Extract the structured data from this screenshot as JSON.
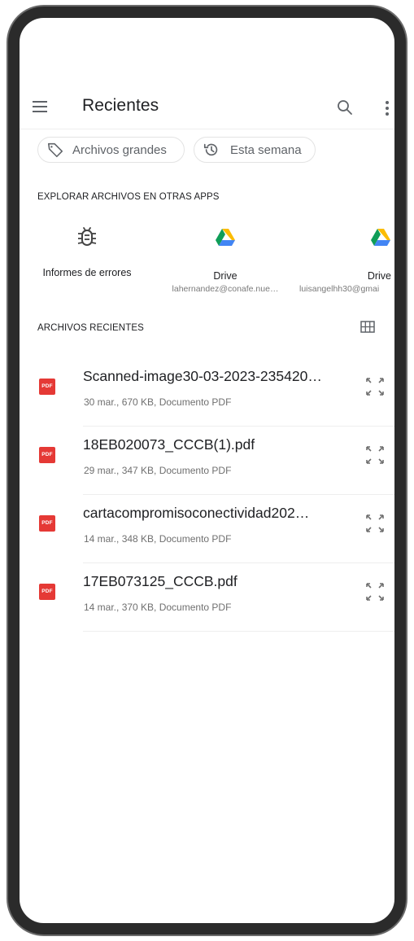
{
  "header": {
    "title": "Recientes",
    "menu_icon": "menu-icon",
    "search_icon": "search-icon",
    "more_icon": "more-vert-icon"
  },
  "chips": [
    {
      "label": "Archivos grandes",
      "icon": "tag-icon"
    },
    {
      "label": "Esta semana",
      "icon": "history-icon"
    }
  ],
  "explore": {
    "heading": "EXPLORAR ARCHIVOS EN OTRAS APPS",
    "apps": [
      {
        "label": "Informes de errores",
        "sub": "",
        "icon": "bug-icon"
      },
      {
        "label": "Drive",
        "sub": "lahernandez@conafe.nue…",
        "icon": "drive-icon"
      },
      {
        "label": "Drive",
        "sub": "luisangelhh30@gmai",
        "icon": "drive-icon"
      }
    ]
  },
  "recent": {
    "heading": "ARCHIVOS RECIENTES",
    "grid_icon": "grid-view-icon",
    "files": [
      {
        "name": "Scanned-image30-03-2023-235420…",
        "meta": "30 mar., 670 KB, Documento PDF",
        "badge": "PDF"
      },
      {
        "name": "18EB020073_CCCB(1).pdf",
        "meta": "29 mar., 347 KB, Documento PDF",
        "badge": "PDF"
      },
      {
        "name": "cartacompromisoconectividad202…",
        "meta": "14 mar., 348 KB, Documento PDF",
        "badge": "PDF"
      },
      {
        "name": "17EB073125_CCCB.pdf",
        "meta": "14 mar., 370 KB, Documento PDF",
        "badge": "PDF"
      }
    ]
  },
  "colors": {
    "pdf_red": "#e53935",
    "text_primary": "#202124",
    "text_secondary": "#6f6f6f",
    "frame": "#2b2b2b"
  }
}
